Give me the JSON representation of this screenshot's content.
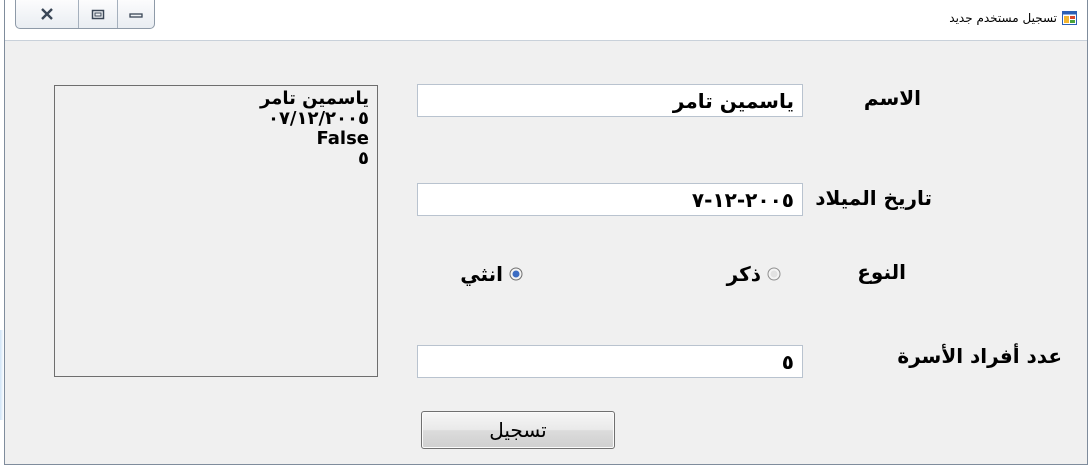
{
  "window": {
    "title": "تسجيل مستخدم جديد",
    "close_icon": "close-icon",
    "maximize_icon": "maximize-icon",
    "minimize_icon": "minimize-icon",
    "app_icon": "form-icon"
  },
  "form": {
    "name_label": "الاسم",
    "name_value": "ياسمين تامر",
    "birthdate_label": "تاريخ الميلاد",
    "birthdate_value": "٢٠٠٥-١٢-٧",
    "gender_label": "النوع",
    "gender_options": [
      {
        "label": "ذكر",
        "selected": false
      },
      {
        "label": "انثي",
        "selected": true
      }
    ],
    "family_label": "عدد أفراد الأسرة",
    "family_value": "٥",
    "submit_label": "تسجيل"
  },
  "output_list": {
    "lines": [
      "ياسمين تامر",
      "٠٧/١٢/٢٠٠٥",
      "False",
      "٥"
    ]
  },
  "colors": {
    "window_bg": "#f0f0f0",
    "textbox_border": "#b9c3cf",
    "radio_selected": "#3b6cc3"
  }
}
